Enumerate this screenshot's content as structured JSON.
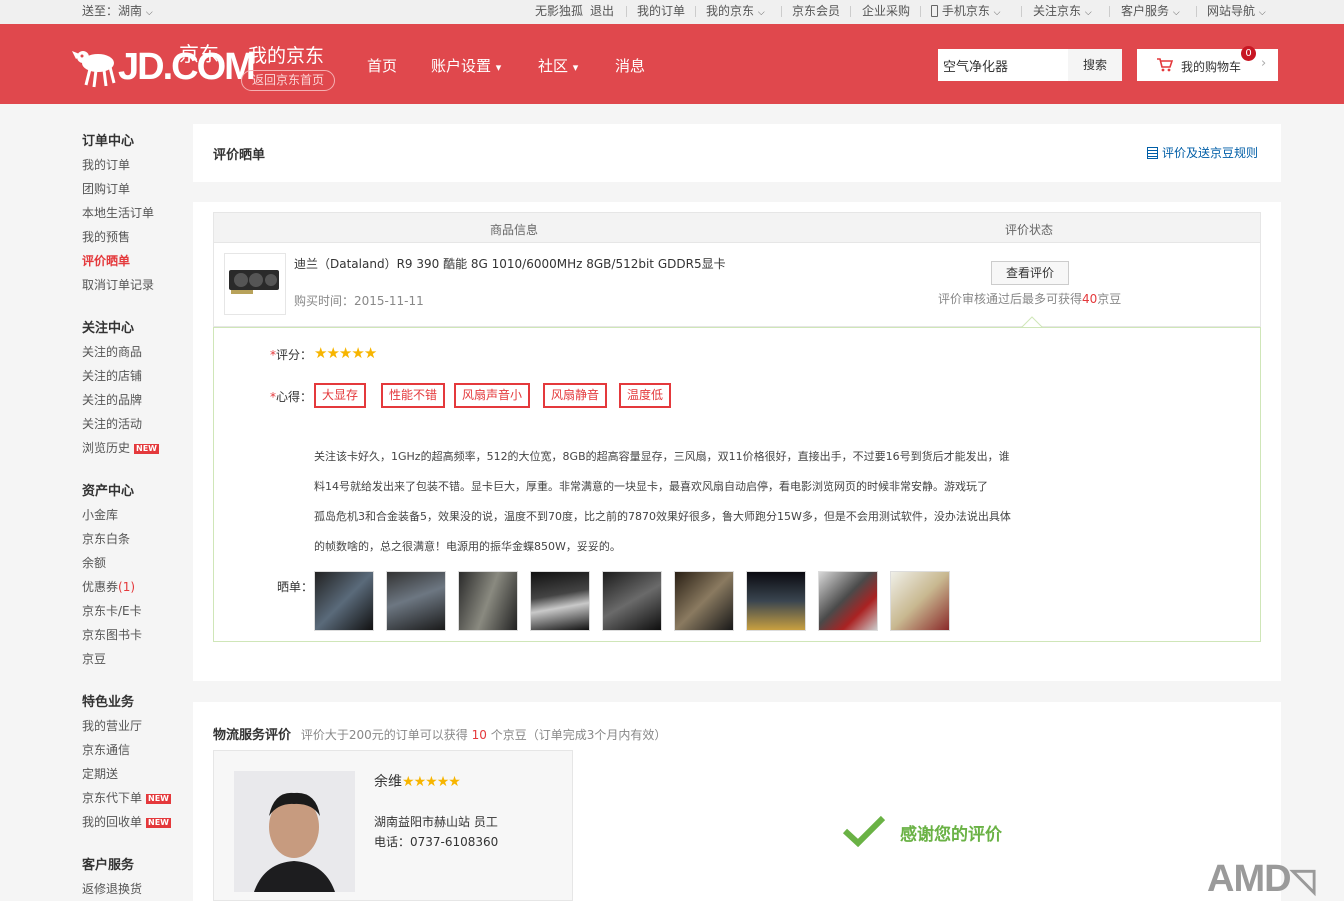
{
  "topbar": {
    "location_label": "送至：湖南",
    "username": "无影独孤",
    "logout": "退出",
    "links": [
      "我的订单",
      "我的京东",
      "京东会员",
      "企业采购",
      "手机京东",
      "关注京东",
      "客户服务",
      "网站导航"
    ]
  },
  "header": {
    "logo_text": "JD.COM",
    "logo_cn": "京东",
    "title": "我的京东",
    "back_home": "返回京东首页",
    "nav": [
      "首页",
      "账户设置",
      "社区",
      "消息"
    ],
    "search_value": "空气净化器",
    "search_button": "搜索",
    "cart_label": "我的购物车",
    "cart_count": "0"
  },
  "sidebar": {
    "sections": [
      {
        "title": "订单中心",
        "items": [
          "我的订单",
          "团购订单",
          "本地生活订单",
          "我的预售",
          "评价晒单",
          "取消订单记录"
        ]
      },
      {
        "title": "关注中心",
        "items": [
          "关注的商品",
          "关注的店铺",
          "关注的品牌",
          "关注的活动",
          "浏览历史"
        ]
      },
      {
        "title": "资产中心",
        "items": [
          "小金库",
          "京东白条",
          "余额",
          "优惠券",
          "京东卡/E卡",
          "京东图书卡",
          "京豆"
        ]
      },
      {
        "title": "特色业务",
        "items": [
          "我的营业厅",
          "京东通信",
          "定期送",
          "京东代下单",
          "我的回收单"
        ]
      },
      {
        "title": "客户服务",
        "items": [
          "返修退换货"
        ]
      }
    ],
    "coupon_count": "(1)",
    "new_badge": "NEW"
  },
  "title_panel": {
    "title": "评价晒单",
    "rule_link": "评价及送京豆规则"
  },
  "table": {
    "col_product": "商品信息",
    "col_status": "评价状态",
    "product_name": "迪兰（Dataland）R9 390 酷能 8G 1010/6000MHz 8GB/512bit GDDR5显卡",
    "buy_time_label": "购买时间：",
    "buy_time": "2015-11-11",
    "view_button": "查看评价",
    "bean_text_before": "评价审核通过后最多可获得",
    "bean_count": "40",
    "bean_text_after": "京豆"
  },
  "review": {
    "rating_label": "评分：",
    "rating": 5,
    "feeling_label": "心得：",
    "tags": [
      "大显存",
      "性能不错",
      "风扇声音小",
      "风扇静音",
      "温度低"
    ],
    "content_lines": [
      "关注该卡好久，1GHz的超高频率，512的大位宽，8GB的超高容量显存，三风扇，双11价格很好，直接出手，不过要16号到货后才能发出，谁",
      "料14号就给发出来了包装不错。显卡巨大，厚重。非常满意的一块显卡，最喜欢风扇自动启停，看电影浏览网页的时候非常安静。游戏玩了",
      "孤岛危机3和合金装备5，效果没的说，温度不到70度，比之前的7870效果好很多，鲁大师跑分15W多，但是不会用测试软件，没办法说出具体",
      "的帧数啥的，总之很满意！电源用的振华金蝶850W，妥妥的。"
    ],
    "photos_label": "晒单："
  },
  "logistics": {
    "title": "物流服务评价",
    "desc_before": "评价大于200元的订单可以获得",
    "desc_count": "10",
    "desc_after": "个京豆（订单完成3个月内有效）",
    "courier_name": "余维",
    "courier_rating": 5,
    "courier_station": "湖南益阳市赫山站 员工",
    "courier_phone": "电话：0737-6108360",
    "thanks": "感谢您的评价"
  },
  "watermark": "AMD",
  "colors": {
    "brand_red": "#e0484d",
    "accent_red": "#e4393c",
    "link_blue": "#005ea7",
    "star": "#f7b500",
    "check_green": "#6ab245"
  }
}
